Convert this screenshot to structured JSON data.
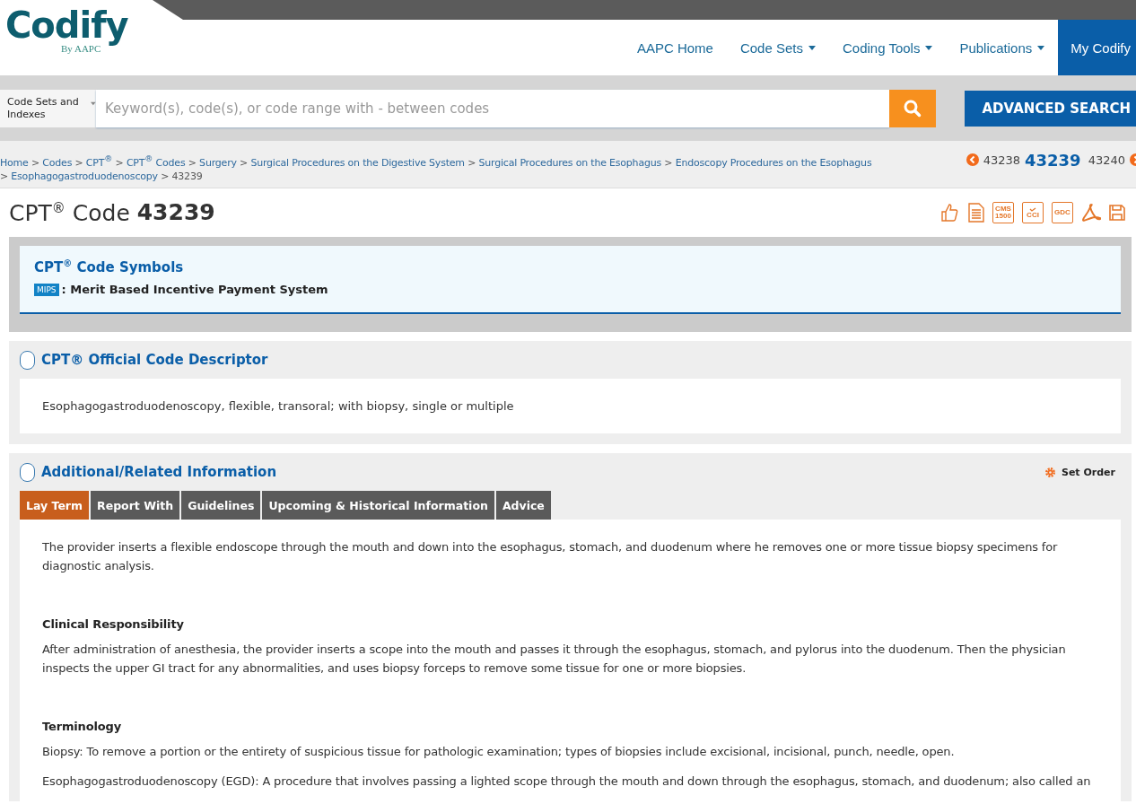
{
  "logo": {
    "name": "Codify",
    "byline": "By AAPC"
  },
  "nav": [
    {
      "label": "AAPC Home",
      "dropdown": false,
      "selected": false
    },
    {
      "label": "Code Sets",
      "dropdown": true,
      "selected": false
    },
    {
      "label": "Coding Tools",
      "dropdown": true,
      "selected": false
    },
    {
      "label": "Publications",
      "dropdown": true,
      "selected": false
    },
    {
      "label": "My Codify",
      "dropdown": false,
      "selected": true
    }
  ],
  "search": {
    "scope": "Code Sets and Indexes",
    "placeholder": "Keyword(s), code(s), or code range with - between codes",
    "advanced": "ADVANCED SEARCH"
  },
  "breadcrumb_separator": ">",
  "breadcrumb": [
    {
      "label": "Home",
      "link": true
    },
    {
      "label": "Codes",
      "link": true
    },
    {
      "label": "CPT$^{®}$",
      "link": true
    },
    {
      "label": "CPT$^{®}$ Codes",
      "link": true
    },
    {
      "label": "Surgery",
      "link": true
    },
    {
      "label": "Surgical Procedures on the Digestive System",
      "link": true
    },
    {
      "label": "Surgical Procedures on the Esophagus",
      "link": true
    },
    {
      "label": "Endoscopy Procedures on the Esophagus",
      "link": true
    },
    {
      "label": "Esophagogastroduodenoscopy",
      "link": true
    },
    {
      "label": "43239",
      "link": false
    }
  ],
  "code_nav": {
    "prev": "43238",
    "current": "43239",
    "next": "43240"
  },
  "title": {
    "prefix": "CPT$^{®}$ Code",
    "code": "43239"
  },
  "toolbar": [
    {
      "kind": "thumbs-up"
    },
    {
      "kind": "document"
    },
    {
      "kind": "labeled",
      "label": "CMS 1500"
    },
    {
      "kind": "check",
      "label": "CCI"
    },
    {
      "kind": "labeled",
      "label": "GDC"
    },
    {
      "kind": "pdf"
    },
    {
      "kind": "save"
    }
  ],
  "symbols": {
    "title": "CPT$^{®}$ Code Symbols",
    "items": [
      {
        "badge": "MIPS",
        "text": ": Merit Based Incentive Payment System"
      }
    ]
  },
  "descriptor": {
    "title": "CPT® Official Code Descriptor",
    "text": "Esophagogastroduodenoscopy, flexible, transoral; with biopsy, single or multiple"
  },
  "additional": {
    "title": "Additional/Related Information",
    "set_order": "Set Order",
    "tabs": [
      {
        "label": "Lay Term",
        "selected": true
      },
      {
        "label": "Report With",
        "selected": false
      },
      {
        "label": "Guidelines",
        "selected": false
      },
      {
        "label": "Upcoming & Historical Information",
        "selected": false
      },
      {
        "label": "Advice",
        "selected": false
      }
    ],
    "content": [
      {
        "kind": "paragraph",
        "text": "The provider inserts a flexible endoscope through the mouth and down into the esophagus, stomach, and duodenum where he removes one or more tissue biopsy specimens for diagnostic analysis."
      },
      {
        "kind": "heading",
        "text": "Clinical Responsibility"
      },
      {
        "kind": "paragraph",
        "text": "After administration of anesthesia, the provider inserts a scope into the mouth and passes it through the esophagus, stomach, and pylorus into the duodenum.  Then the physician inspects the upper GI tract for any abnormalities, and uses biopsy forceps to remove some tissue for one or more biopsies."
      },
      {
        "kind": "heading",
        "text": "Terminology"
      },
      {
        "kind": "paragraph",
        "text": "Biopsy: To remove a portion or the entirety of suspicious tissue for pathologic examination; types of biopsies include excisional, incisional, punch, needle, open."
      },
      {
        "kind": "paragraph",
        "text": "Esophagogastroduodenoscopy (EGD): A procedure that involves passing a lighted scope through the mouth and down through the esophagus, stomach, and duodenum; also called an"
      }
    ]
  }
}
